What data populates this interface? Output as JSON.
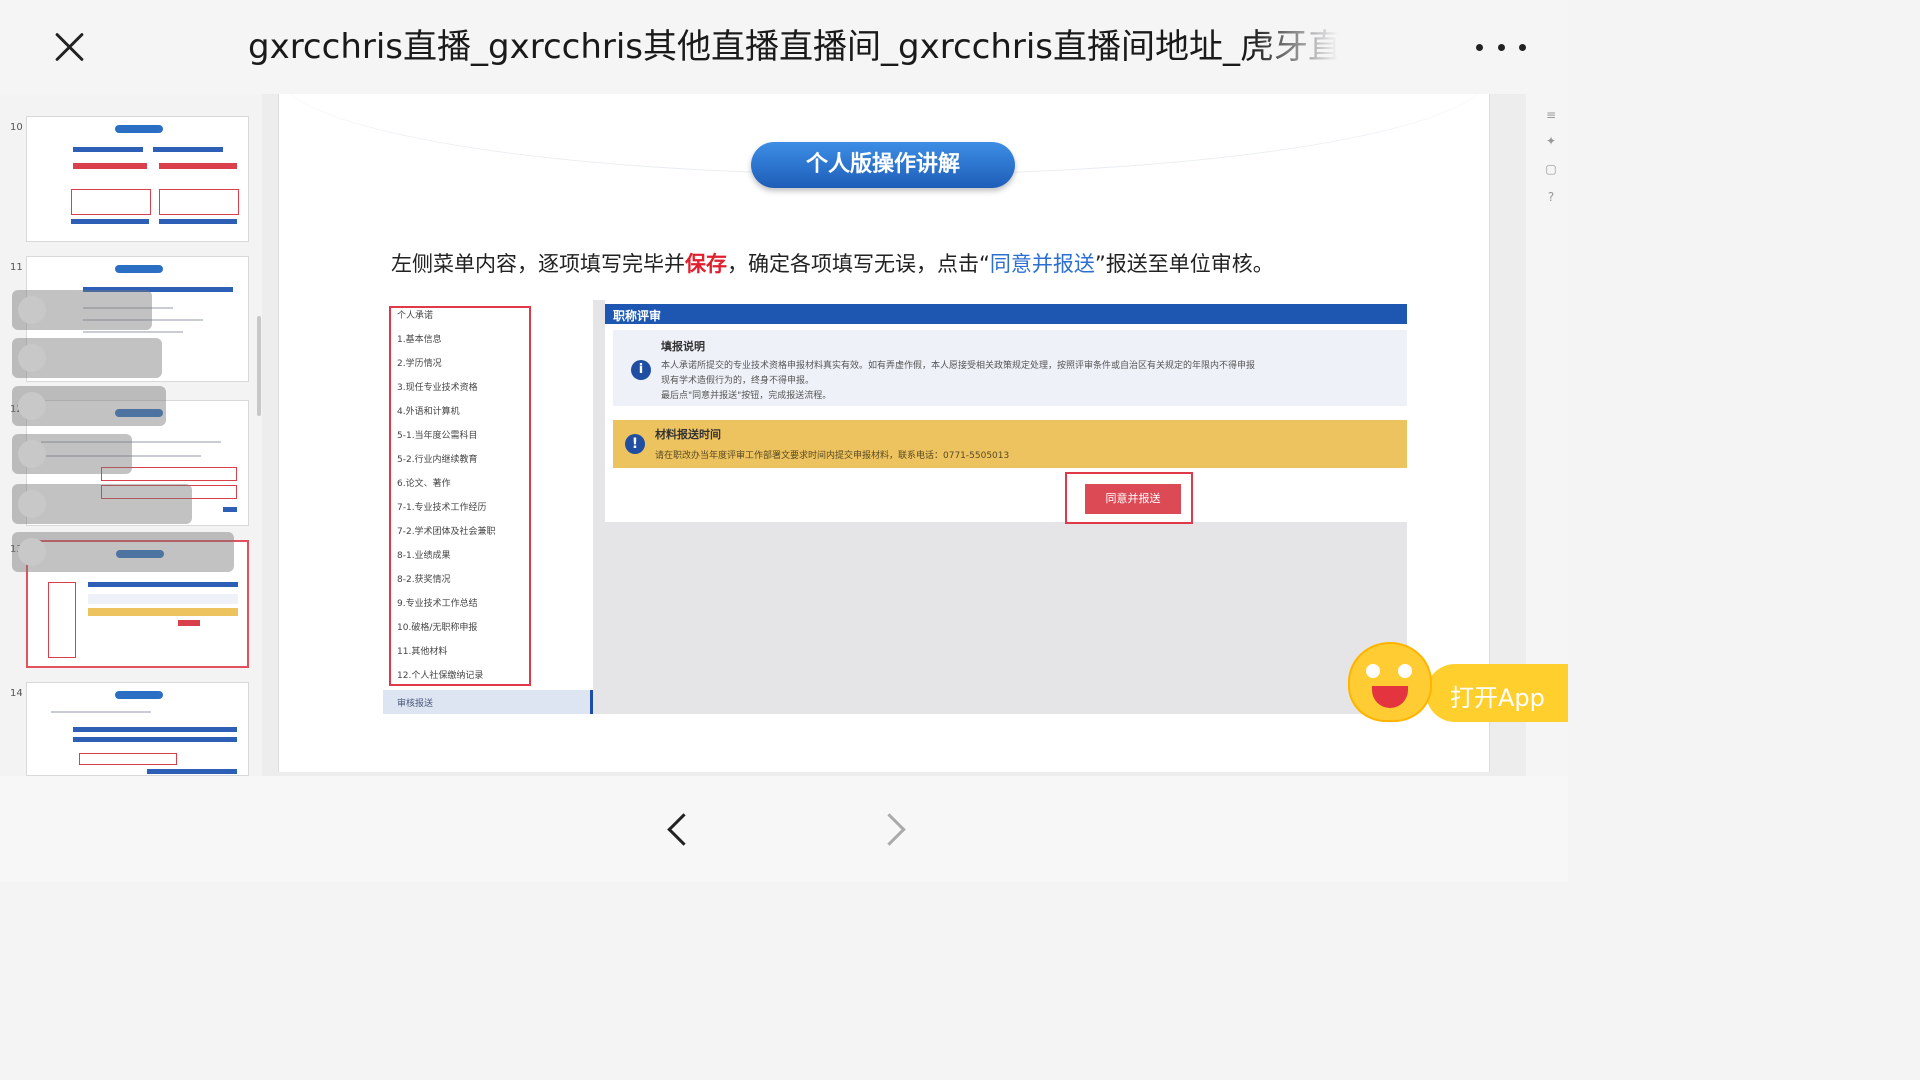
{
  "header": {
    "title": "gxrcchris直播_gxrcchris其他直播直播间_gxrcchris直播间地址_虎牙直播"
  },
  "thumbnails": [
    {
      "num": "10"
    },
    {
      "num": "11"
    },
    {
      "num": "12"
    },
    {
      "num": "13"
    },
    {
      "num": "14"
    }
  ],
  "slide": {
    "heading": "个人版操作讲解",
    "instruction_prefix": "左侧菜单内容，逐项填写完毕并",
    "instruction_save": "保存",
    "instruction_mid": "，确定各项填写无误，点击“",
    "instruction_link": "同意并报送",
    "instruction_suffix": "”报送至单位审核。",
    "menu_items": [
      "个人承诺",
      "1.基本信息",
      "2.学历情况",
      "3.现任专业技术资格",
      "4.外语和计算机",
      "5-1.当年度公需科目",
      "5-2.行业内继续教育",
      "6.论文、著作",
      "7-1.专业技术工作经历",
      "7-2.学术团体及社会兼职",
      "8-1.业绩成果",
      "8-2.获奖情况",
      "9.专业技术工作总结",
      "10.破格/无职称申报",
      "11.其他材料",
      "12.个人社保缴纳记录"
    ],
    "menu_bottom": "审核报送",
    "form_header": "职称评审",
    "notice_title": "填报说明",
    "notice_lines": [
      "本人承诺所提交的专业技术资格申报材料真实有效。如有弄虚作假，本人愿接受相关政策规定处理，按照评审条件或自治区有关规定的年限内不得申报",
      "现有学术造假行为的，终身不得申报。",
      "最后点\"同意并报送\"按钮，完成报送流程。"
    ],
    "warn_title": "材料报送时间",
    "warn_line": "请在职改办当年度评审工作部署文要求时间内提交申报材料，联系电话：0771-5505013",
    "submit_label": "同意并报送"
  },
  "promo": {
    "label": "打开App"
  }
}
